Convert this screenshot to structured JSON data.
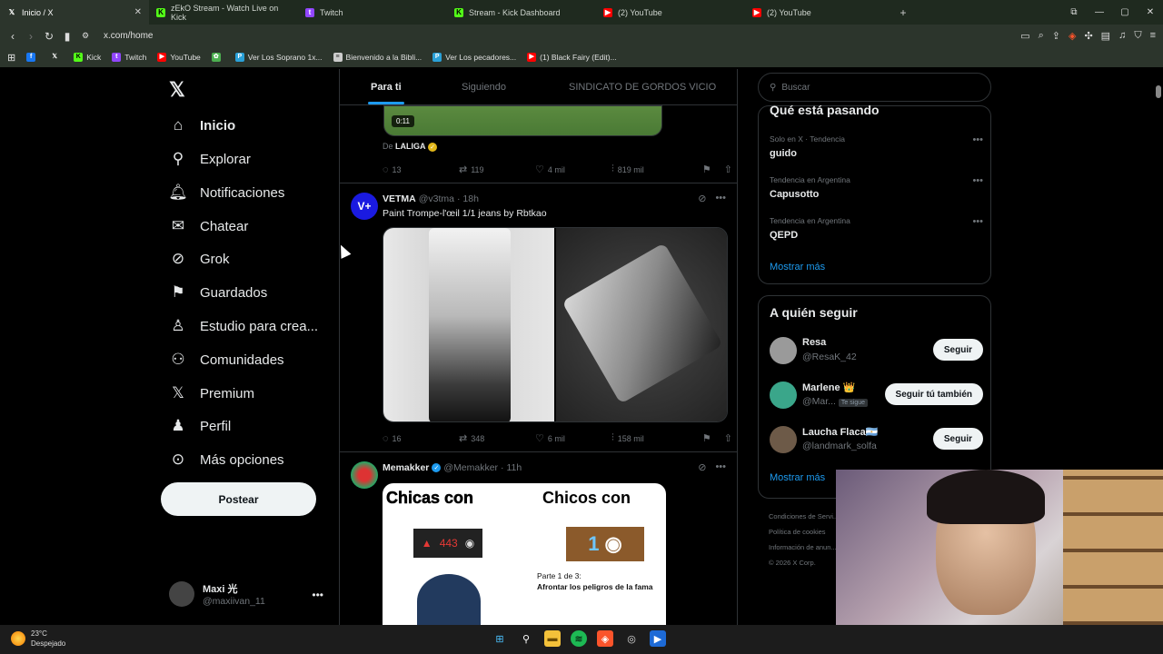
{
  "browser": {
    "tabs": [
      {
        "label": "Inicio / X",
        "icon": "x-logo-icon",
        "active": true
      },
      {
        "label": "zEkO Stream - Watch Live on Kick",
        "icon": "kick-icon"
      },
      {
        "label": "Twitch",
        "icon": "twitch-icon"
      },
      {
        "label": "Stream - Kick Dashboard",
        "icon": "kick-icon"
      },
      {
        "label": "(2) YouTube",
        "icon": "youtube-icon"
      },
      {
        "label": "(2) YouTube",
        "icon": "youtube-icon"
      }
    ],
    "url": "x.com/home",
    "bookmarks": [
      {
        "label": "",
        "icon": "facebook-icon",
        "color": "#1877f2"
      },
      {
        "label": "",
        "icon": "x-logo-icon",
        "color": "#000000"
      },
      {
        "label": "Kick",
        "icon": "kick-icon",
        "color": "#53fc18"
      },
      {
        "label": "Twitch",
        "icon": "twitch-icon",
        "color": "#9146ff"
      },
      {
        "label": "YouTube",
        "icon": "youtube-icon",
        "color": "#ff0000"
      },
      {
        "label": "",
        "icon": "leaf-icon",
        "color": "#4caf50"
      },
      {
        "label": "Ver Los Soprano 1x...",
        "icon": "p-icon",
        "color": "#2aa1d8"
      },
      {
        "label": "Bienvenido a la Bibli...",
        "icon": "doc-icon",
        "color": "#cccccc"
      },
      {
        "label": "Ver Los pecadores...",
        "icon": "p-icon",
        "color": "#2aa1d8"
      },
      {
        "label": "(1) Black Fairy (Edit)...",
        "icon": "youtube-icon",
        "color": "#ff0000"
      }
    ]
  },
  "leftnav": {
    "items": [
      {
        "label": "Inicio",
        "icon": "home-icon"
      },
      {
        "label": "Explorar",
        "icon": "search-icon"
      },
      {
        "label": "Notificaciones",
        "icon": "bell-icon"
      },
      {
        "label": "Chatear",
        "icon": "mail-icon"
      },
      {
        "label": "Grok",
        "icon": "grok-icon"
      },
      {
        "label": "Guardados",
        "icon": "bookmark-icon"
      },
      {
        "label": "Estudio para crea...",
        "icon": "studio-icon"
      },
      {
        "label": "Comunidades",
        "icon": "communities-icon"
      },
      {
        "label": "Premium",
        "icon": "x-logo-icon"
      },
      {
        "label": "Perfil",
        "icon": "person-icon"
      },
      {
        "label": "Más opciones",
        "icon": "more-circle-icon"
      }
    ],
    "post_label": "Postear",
    "profile": {
      "name": "Maxi 光",
      "handle": "@maxiivan_11"
    }
  },
  "feed": {
    "tabs": [
      "Para ti",
      "Siguiendo",
      "SINDICATO DE GORDOS VICIO"
    ],
    "tweet0": {
      "video_time": "0:11",
      "source_prefix": "De",
      "source_name": "LALIGA",
      "replies": "13",
      "reposts": "119",
      "likes": "4 mil",
      "views": "819 mil"
    },
    "tweet1": {
      "name": "VETMA",
      "handle": "@v3tma",
      "time": "· 18h",
      "text": "Paint Trompe-l'œil 1/1 jeans by Rbtkao",
      "replies": "16",
      "reposts": "348",
      "likes": "6 mil",
      "views": "158 mil"
    },
    "tweet2": {
      "name": "Memakker",
      "handle": "@Memakker",
      "time": "· 11h",
      "meme_left": "Chicas con",
      "meme_right": "Chicos con",
      "meme_count": "443",
      "meme_big": "1",
      "meme_part": "Parte 1 de 3:",
      "meme_part_title": "Afrontar los peligros de la fama"
    }
  },
  "rightcol": {
    "search_placeholder": "Buscar",
    "trending_title": "Qué está pasando",
    "trends": [
      {
        "meta": "Solo en X · Tendencia",
        "name": "guido"
      },
      {
        "meta": "Tendencia en Argentina",
        "name": "Capusotto"
      },
      {
        "meta": "Tendencia en Argentina",
        "name": "QEPD"
      }
    ],
    "show_more": "Mostrar más",
    "who_title": "A quién seguir",
    "who": [
      {
        "name": "Resa",
        "handle": "@ResaK_42",
        "button": "Seguir"
      },
      {
        "name": "Marlene 👑",
        "handle": "@Mar...",
        "badge": "Te sigue",
        "button": "Seguir tú también"
      },
      {
        "name": "Laucha Flaca🇦🇷",
        "handle": "@landmark_solfa",
        "button": "Seguir"
      }
    ],
    "footer": [
      "Condiciones de Servi...",
      "Política de cookies",
      "Información de anun...",
      "© 2026 X Corp."
    ]
  },
  "taskbar": {
    "temp": "23°C",
    "weather": "Despejado"
  }
}
